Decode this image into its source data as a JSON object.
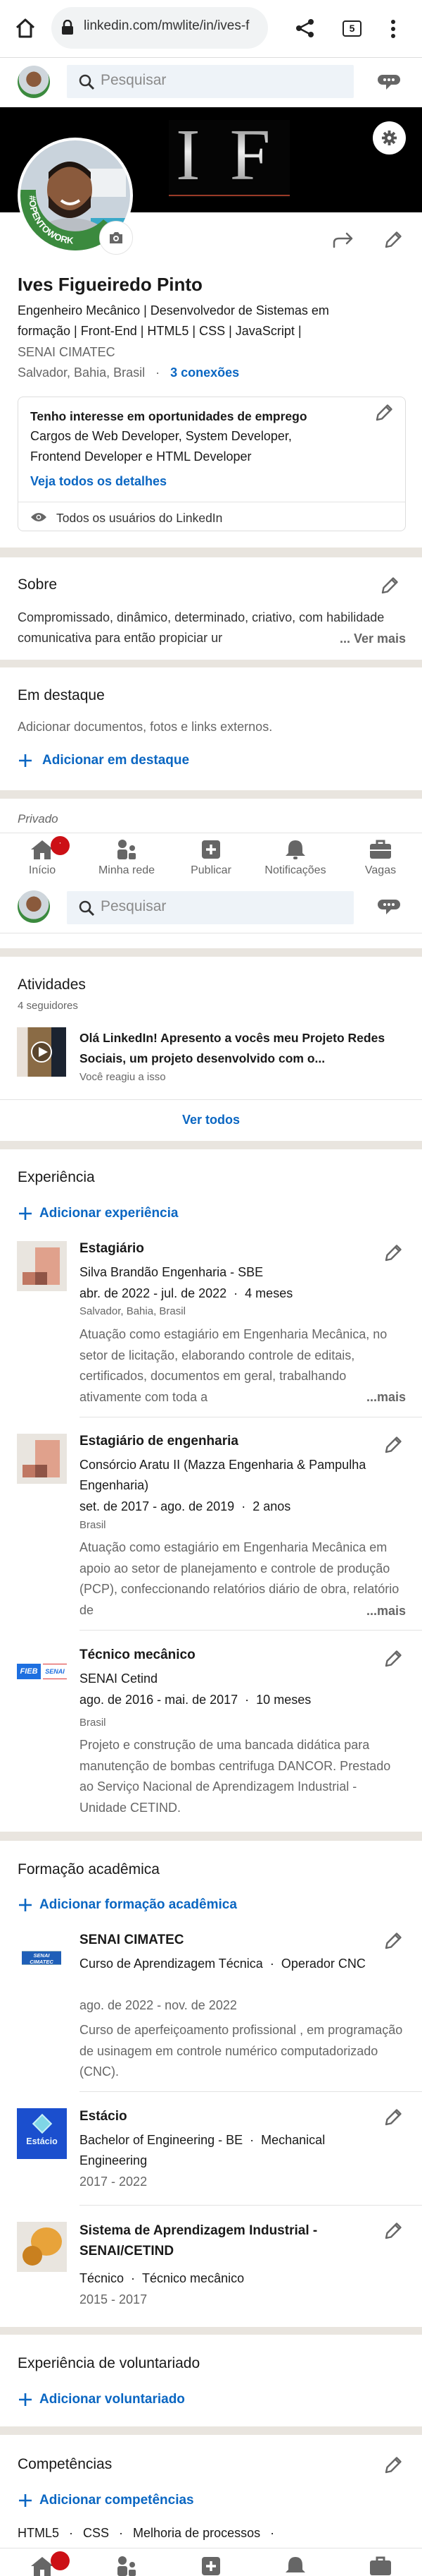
{
  "browser": {
    "url": "linkedin.com/mwlite/in/ives-f",
    "tab_count": "5"
  },
  "header": {
    "search_placeholder": "Pesquisar"
  },
  "banner": {
    "logo_text": "IF"
  },
  "profile": {
    "badge_text": "#OPENTOWORK",
    "name": "Ives Figueiredo Pinto",
    "headline": "Engenheiro Mecânico | Desenvolvedor de Sistemas em formação | Front-End | HTML5 | CSS | JavaScript |",
    "education": "SENAI CIMATEC",
    "location": "Salvador, Bahia, Brasil",
    "separator": "·",
    "connections": "3 conexões"
  },
  "open_to_work": {
    "title": "Tenho interesse em oportunidades de emprego",
    "roles": "Cargos de Web Developer, System Developer, Frontend Developer e HTML Developer",
    "details_link": "Veja todos os detalhes",
    "visibility": "Todos os usuários do LinkedIn"
  },
  "about": {
    "title": "Sobre",
    "text": "Compromissado, dinâmico, determinado, criativo, com habilidade comunicativa para então propiciar ur",
    "more": "... Ver mais"
  },
  "featured": {
    "title": "Em destaque",
    "hint": "Adicionar documentos, fotos e links externos.",
    "add_label": "Adicionar em destaque",
    "private_label": "Privado"
  },
  "nav": {
    "items": [
      {
        "label": "Início",
        "icon": "home-icon"
      },
      {
        "label": "Minha rede",
        "icon": "network-icon"
      },
      {
        "label": "Publicar",
        "icon": "post-icon"
      },
      {
        "label": "Notificações",
        "icon": "bell-icon"
      },
      {
        "label": "Vagas",
        "icon": "briefcase-icon"
      }
    ],
    "badge_text": "·",
    "badge_color": "#cc1016"
  },
  "activity": {
    "title": "Atividades",
    "followers": "4 seguidores",
    "post_text": "Olá LinkedIn! Apresento a vocês meu Projeto Redes Sociais, um projeto desenvolvido com o...",
    "post_meta": "Você reagiu a isso",
    "see_all": "Ver todos"
  },
  "experience": {
    "title": "Experiência",
    "add_label": "Adicionar experiência",
    "more_label": "...mais",
    "items": [
      {
        "title": "Estagiário",
        "company": "Silva Brandão Engenharia - SBE",
        "dates": "abr. de 2022 - jul. de 2022",
        "duration": "4 meses",
        "location": "Salvador, Bahia, Brasil",
        "description": "Atuação como estagiário em Engenharia Mecânica, no setor de licitação, elaborando controle de editais, certificados, documentos em geral, trabalhando ativamente com toda a"
      },
      {
        "title": "Estagiário de engenharia",
        "company": "Consórcio Aratu II (Mazza Engenharia & Pampulha Engenharia)",
        "dates": "set. de 2017 - ago. de 2019",
        "duration": "2 anos",
        "location": "Brasil",
        "description": "Atuação como estagiário em Engenharia Mecânica em apoio ao setor de planejamento e controle de produção (PCP), confeccionando relatórios diário de obra, relatório de"
      },
      {
        "title": "Técnico mecânico",
        "company": "SENAI Cetind",
        "dates": "ago. de 2016 - mai. de 2017",
        "duration": "10 meses",
        "location": "Brasil",
        "description": "Projeto e construção de uma bancada didática para manutenção de bombas centrifuga DANCOR. Prestado ao Serviço Nacional de Aprendizagem Industrial - Unidade CETIND.",
        "logo_text": "FIEB SENAI"
      }
    ]
  },
  "education": {
    "title": "Formação acadêmica",
    "add_label": "Adicionar formação acadêmica",
    "items": [
      {
        "school": "SENAI CIMATEC",
        "degree": "Curso de Aprendizagem Técnica",
        "field": "Operador CNC",
        "dates": "ago. de 2022 - nov. de 2022",
        "description": "Curso de aperfeiçoamento profissional , em programação de usinagem em controle numérico computadorizado (CNC).",
        "logo_text": "SENAI CIMATEC"
      },
      {
        "school": "Estácio",
        "degree": "Bachelor of Engineering - BE",
        "field": "Mechanical Engineering",
        "dates": "2017 - 2022",
        "logo_text": "Estácio"
      },
      {
        "school": "Sistema de Aprendizagem Industrial - SENAI/CETIND",
        "degree": "Técnico",
        "field": "Técnico mecânico",
        "dates": "2015 - 2017"
      }
    ]
  },
  "volunteer": {
    "title": "Experiência de voluntariado",
    "add_label": "Adicionar voluntariado"
  },
  "skills": {
    "title": "Competências",
    "add_label": "Adicionar competências",
    "items": [
      "HTML5",
      "CSS",
      "Melhoria de processos"
    ],
    "separator": "·"
  },
  "colors": {
    "accent": "#0a66c2",
    "band": "#e9e5df",
    "badge": "#cc1016",
    "opentowork": "#3b8a3e"
  }
}
